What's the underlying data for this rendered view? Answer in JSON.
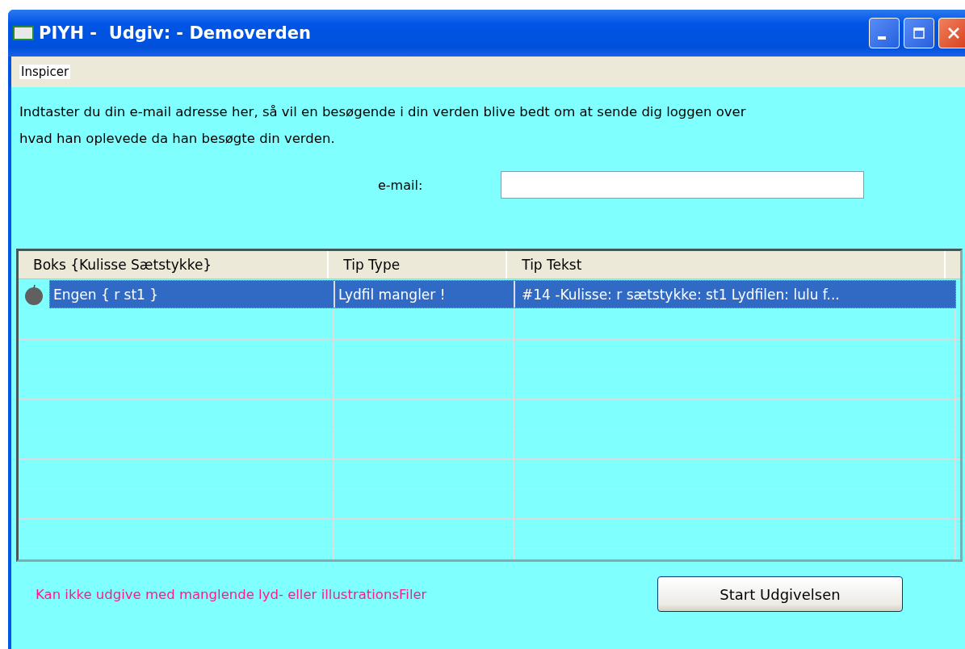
{
  "window": {
    "title": "PIYH -  Udgiv: - Demoverden"
  },
  "menu": [
    "Inspicer"
  ],
  "intro": "Indtaster du din e-mail adresse her, så vil en besøgende i din verden blive bedt om at sende dig loggen over hvad han oplevede da han besøgte din verden.",
  "email": {
    "label": "e-mail:"
  },
  "table": {
    "columns": [
      "Boks {Kulisse Sætstykke}",
      "Tip Type",
      "Tip Tekst"
    ],
    "rows": [
      {
        "selected": true,
        "cells": [
          "Engen { r st1 }",
          "Lydfil mangler !",
          "#14 -Kulisse: r sætstykke: st1 Lydfilen: lulu f..."
        ]
      }
    ]
  },
  "warning": "Kan ikke udgive med manglende lyd- eller illustrationsFiler",
  "button": "Start Udgivelsen"
}
